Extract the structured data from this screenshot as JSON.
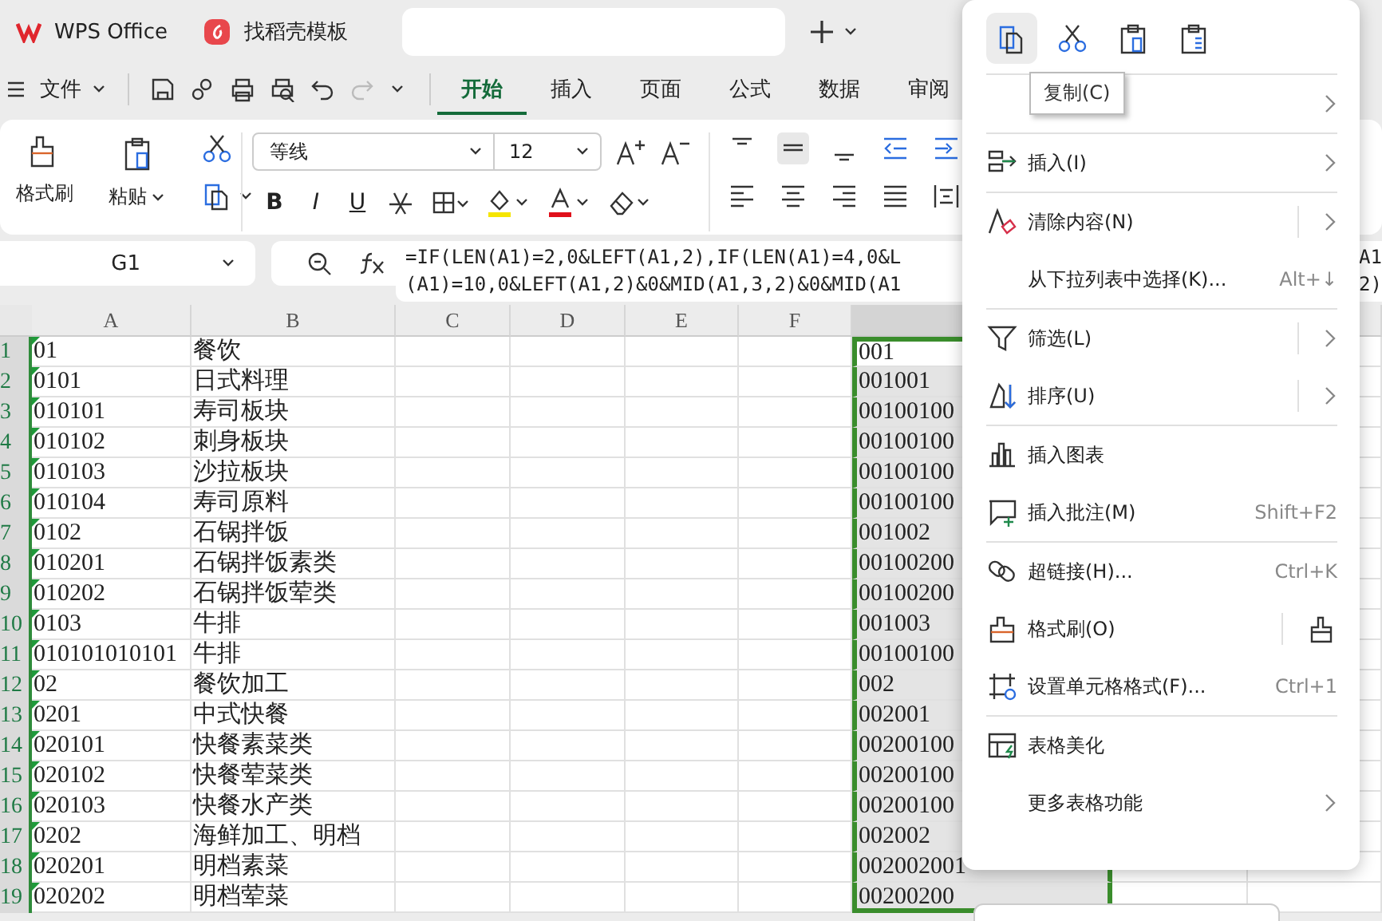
{
  "tabs": [
    {
      "label": "WPS Office",
      "selected": false
    },
    {
      "label": "找稻壳模板",
      "selected": false
    },
    {
      "selected": true
    }
  ],
  "menu_bar": {
    "file": "文件",
    "tabs": [
      {
        "label": "开始",
        "selected": true
      },
      {
        "label": "插入",
        "selected": false
      },
      {
        "label": "页面",
        "selected": false
      },
      {
        "label": "公式",
        "selected": false
      },
      {
        "label": "数据",
        "selected": false
      },
      {
        "label": "审阅",
        "selected": false
      }
    ]
  },
  "ribbon": {
    "format_painter": "格式刷",
    "paste": "粘贴",
    "font": "等线",
    "font_size": "12",
    "style_buttons": [
      "B",
      "I",
      "U"
    ]
  },
  "name_box": "G1",
  "formula": [
    "=IF(LEN(A1)=2,0&LEFT(A1,2),IF(LEN(A1)=4,0&L",
    "(A1)=10,0&LEFT(A1,2)&0&MID(A1,3,2)&0&MID(A1"
  ],
  "formula_overflow": [
    "A1",
    "2)"
  ],
  "sheet": {
    "columns": [
      "A",
      "B",
      "C",
      "D",
      "E",
      "F"
    ],
    "rows": [
      {
        "number": "1",
        "a": "01",
        "b": "餐饮",
        "g": "001"
      },
      {
        "number": "2",
        "a": "0101",
        "b": "日式料理",
        "g": "001001"
      },
      {
        "number": "3",
        "a": "010101",
        "b": "寿司板块",
        "g": "00100100"
      },
      {
        "number": "4",
        "a": "010102",
        "b": "刺身板块",
        "g": "00100100"
      },
      {
        "number": "5",
        "a": "010103",
        "b": "沙拉板块",
        "g": "00100100"
      },
      {
        "number": "6",
        "a": "010104",
        "b": "寿司原料",
        "g": "00100100"
      },
      {
        "number": "7",
        "a": "0102",
        "b": "石锅拌饭",
        "g": "001002"
      },
      {
        "number": "8",
        "a": "010201",
        "b": "石锅拌饭素类",
        "g": "00100200"
      },
      {
        "number": "9",
        "a": "010202",
        "b": "石锅拌饭荤类",
        "g": "00100200"
      },
      {
        "number": "10",
        "a": "0103",
        "b": "牛排",
        "g": "001003"
      },
      {
        "number": "11",
        "a": "010101010101",
        "b": "牛排",
        "g": "00100100"
      },
      {
        "number": "12",
        "a": "02",
        "b": "餐饮加工",
        "g": "002"
      },
      {
        "number": "13",
        "a": "0201",
        "b": "中式快餐",
        "g": "002001"
      },
      {
        "number": "14",
        "a": "020101",
        "b": "快餐素菜类",
        "g": "00200100"
      },
      {
        "number": "15",
        "a": "020102",
        "b": "快餐荤菜类",
        "g": "00200100"
      },
      {
        "number": "16",
        "a": "020103",
        "b": "快餐水产类",
        "g": "00200100"
      },
      {
        "number": "17",
        "a": "0202",
        "b": "海鲜加工、明档",
        "g": "002002"
      },
      {
        "number": "18",
        "a": "020201",
        "b": "明档素菜",
        "g": "002002001"
      },
      {
        "number": "19",
        "a": "020202",
        "b": "明档荤菜",
        "g": "00200200"
      }
    ]
  },
  "context_menu": {
    "quick_actions": [
      {
        "selected": true
      },
      {
        "selected": false
      },
      {
        "selected": false
      },
      {
        "selected": false
      }
    ],
    "tooltip": "复制(C)",
    "groups": [
      [
        {
          "submenu": true
        }
      ],
      [
        {
          "label": "插入(I)",
          "submenu": true
        }
      ],
      [
        {
          "label": "清除内容(N)",
          "submenu": true,
          "split": true
        },
        {
          "label": "从下拉列表中选择(K)...",
          "shortcut": "Alt+↓"
        }
      ],
      [
        {
          "label": "筛选(L)",
          "submenu": true,
          "split": true
        },
        {
          "label": "排序(U)",
          "submenu": true,
          "split": true
        }
      ],
      [
        {
          "label": "插入图表"
        },
        {
          "label": "插入批注(M)",
          "shortcut": "Shift+F2"
        }
      ],
      [
        {
          "label": "超链接(H)...",
          "shortcut": "Ctrl+K"
        },
        {
          "label": "格式刷(O)",
          "split": true,
          "brush": true
        },
        {
          "label": "设置单元格格式(F)...",
          "shortcut": "Ctrl+1"
        }
      ],
      [
        {
          "label": "表格美化"
        },
        {
          "label": "更多表格功能",
          "submenu": true
        }
      ]
    ]
  }
}
